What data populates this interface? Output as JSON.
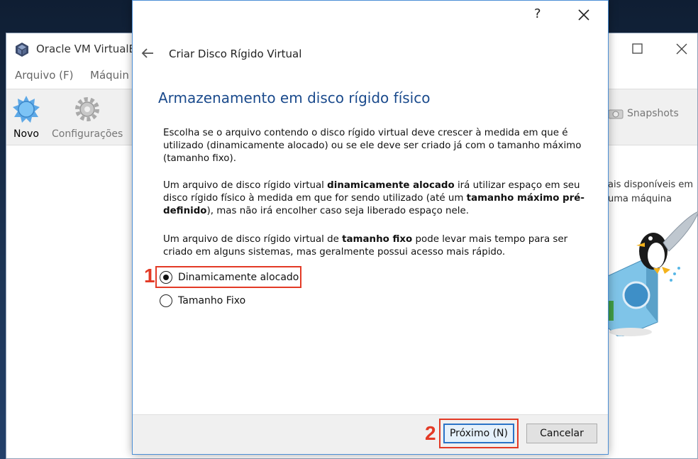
{
  "vbox": {
    "title": "Oracle VM VirtualB",
    "menu": [
      "Arquivo (F)",
      "Máquin"
    ],
    "toolbar": {
      "new_label": "Novo",
      "settings_label": "Configurações",
      "snapshots_label": "Snapshots"
    },
    "right_text_line1": "ais disponíveis em",
    "right_text_line2": "uma máquina"
  },
  "wizard": {
    "help_glyph": "?",
    "title": "Criar Disco Rígido Virtual",
    "heading": "Armazenamento em disco rígido físico",
    "paragraph1": "Escolha se o arquivo contendo o disco rígido virtual deve crescer à medida em que é utilizado (dinamicamente alocado) ou se ele deve ser criado já com o tamanho máximo (tamanho fixo).",
    "paragraph2": {
      "part1": "Um arquivo de disco rígido virtual ",
      "bold1": "dinamicamente alocado",
      "part2": " irá utilizar espaço em seu disco rígido físico à medida em que for sendo utilizado (até um ",
      "bold2": "tamanho máximo pré-definido",
      "part3": "), mas não irá encolher caso seja liberado espaço nele."
    },
    "paragraph3": {
      "part1": "Um arquivo de disco rígido virtual de ",
      "bold1": "tamanho fixo",
      "part2": " pode levar mais tempo para ser criado em alguns sistemas, mas geralmente possui acesso mais rápido."
    },
    "options": [
      {
        "label": "Dinamicamente alocado",
        "selected": true
      },
      {
        "label": "Tamanho Fixo",
        "selected": false
      }
    ],
    "next_button": "Próximo (N)",
    "cancel_button": "Cancelar"
  },
  "annotations": {
    "step1": "1",
    "step2": "2",
    "color": "#e33a26"
  }
}
